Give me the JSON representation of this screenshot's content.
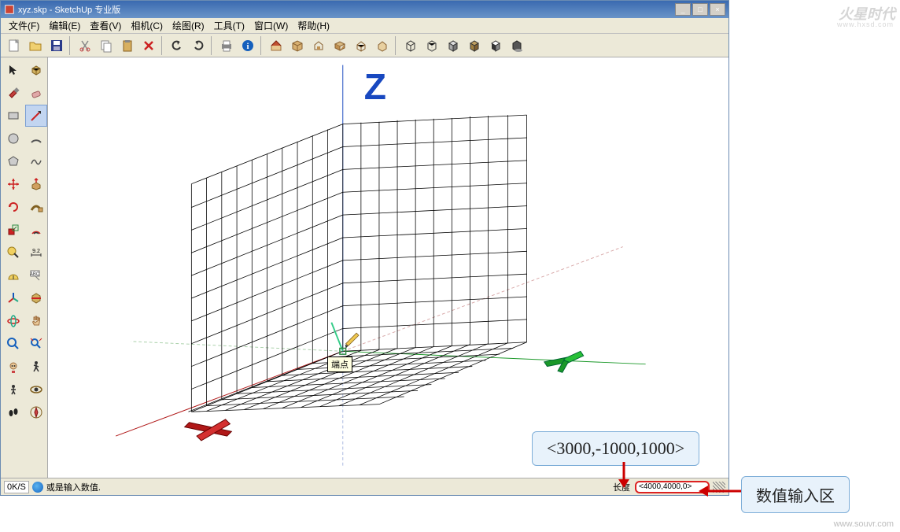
{
  "title": "xyz.skp - SketchUp 专业版",
  "menu": {
    "file": "文件(F)",
    "edit": "编辑(E)",
    "view": "查看(V)",
    "camera": "相机(C)",
    "draw": "绘图(R)",
    "tools": "工具(T)",
    "window": "窗口(W)",
    "help": "帮助(H)"
  },
  "status": {
    "left_badge": "0K/S",
    "text": "或是输入数值.",
    "vcb_label": "长度",
    "vcb_value": "<4000,4000,0>"
  },
  "tooltip": "端点",
  "axis_label": "Z",
  "callouts": {
    "coord": "<3000,-1000,1000>",
    "desc": "数值输入区"
  },
  "watermark": {
    "top": "火星时代",
    "top_sub": "www.hxsd.com",
    "bottom": "www.souvr.com"
  },
  "top_toolbar_icons": [
    "new-file-icon",
    "open-file-icon",
    "save-icon",
    "cut-icon",
    "copy-icon",
    "paste-icon",
    "delete-icon",
    "undo-icon",
    "redo-icon",
    "print-icon",
    "info-icon",
    "house-icon",
    "box-model-icon",
    "front-icon",
    "iso1-icon",
    "iso2-icon",
    "iso3-icon",
    "wire-cube-icon",
    "hidden-line-icon",
    "shaded-icon",
    "textured-icon",
    "monochrome-icon",
    "shadow-icon"
  ],
  "left_toolbar_icons": [
    "select-icon",
    "component-icon",
    "paint-icon",
    "eraser-icon",
    "rectangle-icon",
    "line-icon",
    "circle-icon",
    "arc-icon",
    "polygon-icon",
    "freehand-icon",
    "move-icon",
    "pushpull-icon",
    "rotate-icon",
    "followme-icon",
    "scale-icon",
    "offset-icon",
    "tape-icon",
    "dimension-icon",
    "protractor-icon",
    "text-icon",
    "axes-icon",
    "section-icon",
    "orbit-icon",
    "pan-icon",
    "zoom-icon",
    "zoom-extents-icon",
    "look-icon",
    "walk-icon",
    "position-icon",
    "eye-icon",
    "footprint-icon",
    "compass-icon"
  ],
  "icon_colors": {
    "file": "#d8a040",
    "save": "#2a3a8a",
    "cut": "#888",
    "delete": "#c22",
    "undo": "#333",
    "print": "#555",
    "info": "#1560bd",
    "house": "#d88",
    "box": "#c9a060",
    "cube": "#555",
    "shadow": "#333",
    "select": "#222",
    "paint": "#c2403c",
    "eraser": "#d09898",
    "rect": "#888",
    "line": "#c22",
    "circle": "#888",
    "arc": "#888",
    "poly": "#888",
    "move": "#c22",
    "pushpull": "#c09050",
    "rotate": "#c22",
    "scale": "#2a8a40",
    "offset": "#c22",
    "tape": "#c9a040",
    "protractor": "#c9a040",
    "text": "#777",
    "axes": "#1560bd",
    "section": "#c9a040",
    "orbit": "#c22",
    "pan": "#c2a060",
    "zoom": "#1560bd",
    "look": "#c22",
    "walk": "#c09050",
    "foot": "#222"
  }
}
